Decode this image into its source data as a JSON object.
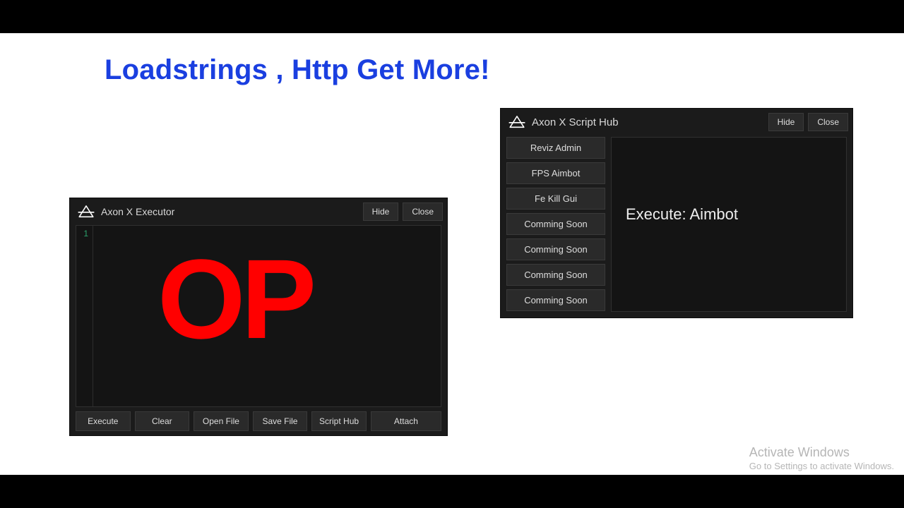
{
  "headline": "Loadstrings , Http Get More!",
  "overlay": "OP",
  "watermark": {
    "l1": "Activate Windows",
    "l2": "Go to Settings to activate Windows."
  },
  "executor": {
    "title": "Axon X Executor",
    "titlebar_buttons": {
      "hide": "Hide",
      "close": "Close"
    },
    "line_number": "1",
    "toolbar": {
      "execute": "Execute",
      "clear": "Clear",
      "open_file": "Open File",
      "save_file": "Save File",
      "script_hub": "Script Hub",
      "attach": "Attach"
    }
  },
  "hub": {
    "title": "Axon X Script Hub",
    "titlebar_buttons": {
      "hide": "Hide",
      "close": "Close"
    },
    "items": [
      "Reviz Admin",
      "FPS Aimbot",
      "Fe Kill Gui",
      "Comming Soon",
      "Comming Soon",
      "Comming Soon",
      "Comming Soon"
    ],
    "execute_label": "Execute: Aimbot"
  }
}
